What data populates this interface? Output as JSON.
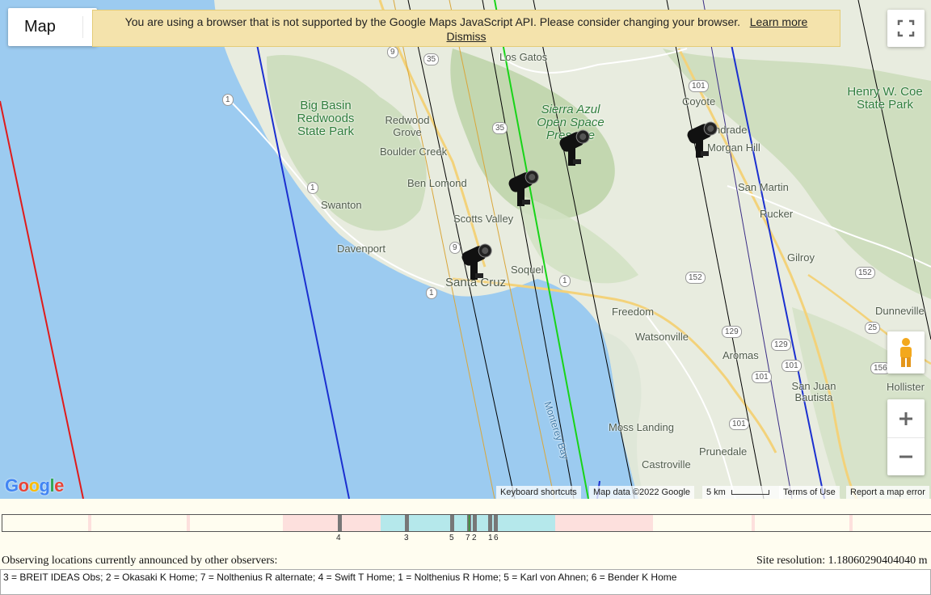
{
  "map": {
    "map_type_label": "Map",
    "warning": {
      "text": "You are using a browser that is not supported by the Google Maps JavaScript API. Please consider changing your browser.",
      "learn_more": "Learn more",
      "dismiss": "Dismiss"
    },
    "places": {
      "los_gatos": "Los Gatos",
      "big_basin": "Big Basin Redwoods State Park",
      "redwood_grove": "Redwood Grove",
      "boulder_creek": "Boulder Creek",
      "ben_lomond": "Ben Lomond",
      "swanton": "Swanton",
      "scotts_valley": "Scotts Valley",
      "davenport": "Davenport",
      "santa_cruz": "Santa Cruz",
      "soquel": "Soquel",
      "sierra_azul": "Sierra Azul Open Space Preserve",
      "coyote": "Coyote",
      "morgan_hill": "Morgan Hill",
      "san_martin": "San Martin",
      "rucker": "Rucker",
      "gilroy": "Gilroy",
      "henry_coe": "Henry W. Coe State Park",
      "freedom": "Freedom",
      "watsonville": "Watsonville",
      "aromas": "Aromas",
      "san_juan": "San Juan Bautista",
      "hollister": "Hollister",
      "dunneville": "Dunneville",
      "moss_landing": "Moss Landing",
      "prunedale": "Prunedale",
      "castroville": "Castroville",
      "monterey_bay": "Monterey Bay",
      "andrade": "ndrade"
    },
    "shields": [
      "9",
      "35",
      "1",
      "101",
      "35",
      "1",
      "1",
      "9",
      "1",
      "152",
      "152",
      "129",
      "129",
      "101",
      "101",
      "25",
      "156",
      "101"
    ],
    "footer": {
      "keyboard": "Keyboard shortcuts",
      "mapdata": "Map data ©2022 Google",
      "scale": "5 km",
      "terms": "Terms of Use",
      "report": "Report a map error"
    },
    "logo": "Google",
    "icons": [
      "fullscreen-icon",
      "pegman-icon",
      "zoom-in-icon",
      "zoom-out-icon",
      "observer-camera-icon"
    ]
  },
  "timeline": {
    "labels": [
      "4",
      "3",
      "5",
      "7",
      "2",
      "1",
      "6"
    ]
  },
  "status": {
    "observing_label": "Observing locations currently announced by other observers:",
    "site_resolution": "Site resolution: 1.18060290404040 m"
  },
  "observers_text": "3 = BREIT IDEAS Obs; 2 = Okasaki K Home; 7 = Nolthenius R alternate; 4 = Swift T Home; 1 = Nolthenius R Home; 5 = Karl von Ahnen; 6 = Bender K Home"
}
